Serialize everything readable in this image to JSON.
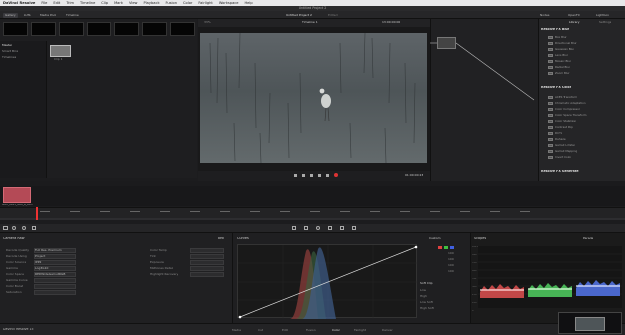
{
  "menubar": {
    "items": [
      "DaVinci Resolve",
      "File",
      "Edit",
      "Trim",
      "Timeline",
      "Clip",
      "Mark",
      "View",
      "Playback",
      "Fusion",
      "Color",
      "Fairlight",
      "Workspace",
      "Help"
    ]
  },
  "titlebar": {
    "title": "Untitled Project 2"
  },
  "toolbar": {
    "left": [
      "Gallery",
      "LUTs",
      "Media Pool",
      "Timeline"
    ],
    "center": "Untitled Project 2",
    "center_sub": "Edited",
    "timeline_name": "Timeline 1",
    "timecode": "13:00:00:00",
    "clip_label": "Clip",
    "right": [
      "Nodes",
      "OpenFX",
      "Lightbox"
    ],
    "zoom": "33%"
  },
  "mediapool": {
    "bins": [
      "Master",
      "Smart Bins",
      "Timelines"
    ],
    "clip_name": "Clip 1"
  },
  "viewer": {
    "timecode": "01:00:00:23"
  },
  "library": {
    "tabs": [
      "Library",
      "Settings"
    ],
    "sections": [
      {
        "title": "Resolve FX Blur",
        "items": [
          "Box Blur",
          "Directional Blur",
          "Gaussian Blur",
          "Lens Blur",
          "Mosaic Blur",
          "Radial Blur",
          "Zoom Blur"
        ]
      },
      {
        "title": "Resolve FX Color",
        "items": [
          "ACES Transform",
          "Chromatic Adaptation",
          "Color Compressor",
          "Color Space Transform",
          "Color Stabilizer",
          "Contrast Pop",
          "DCTL",
          "Dehaze",
          "Gamut Limiter",
          "Gamut Mapping",
          "Invert Color"
        ]
      },
      {
        "title": "Resolve FX Generate",
        "items": []
      }
    ]
  },
  "timeline": {
    "clip_label": "MAH_0163_M09_B_L0I5"
  },
  "camera_raw": {
    "title": "Camera Raw",
    "right_label": "RED",
    "fields_left": [
      "Decode Quality",
      "Decode Using",
      "Color Science",
      "Gamma",
      "Color Space",
      "Gamma Curve",
      "Color Boost",
      "Saturation"
    ],
    "fields_right": [
      "Color Temp",
      "Tint",
      "Exposure",
      "Midtones Detail",
      "Highlight Recovery"
    ],
    "values": [
      "Full Res. Premium",
      "Project",
      "IPP2",
      "Log3G10",
      "REDWideGamutRGB"
    ]
  },
  "curves": {
    "title": "Curves",
    "edit_label": "Custom",
    "channel_values": [
      "100",
      "100",
      "100",
      "100"
    ],
    "soft_clip": "Soft Clip",
    "low": "Low",
    "high": "High",
    "low_soft": "Low Soft",
    "high_soft": "High Soft"
  },
  "scope": {
    "title": "Scopes",
    "mode": "Parade",
    "scale": [
      "1023",
      "896",
      "768",
      "640",
      "512",
      "384",
      "256",
      "128",
      "0"
    ]
  },
  "bottomnav": {
    "items": [
      "Media",
      "Cut",
      "Edit",
      "Fusion",
      "Color",
      "Fairlight",
      "Deliver"
    ],
    "app_name": "DaVinci Resolve 15"
  }
}
